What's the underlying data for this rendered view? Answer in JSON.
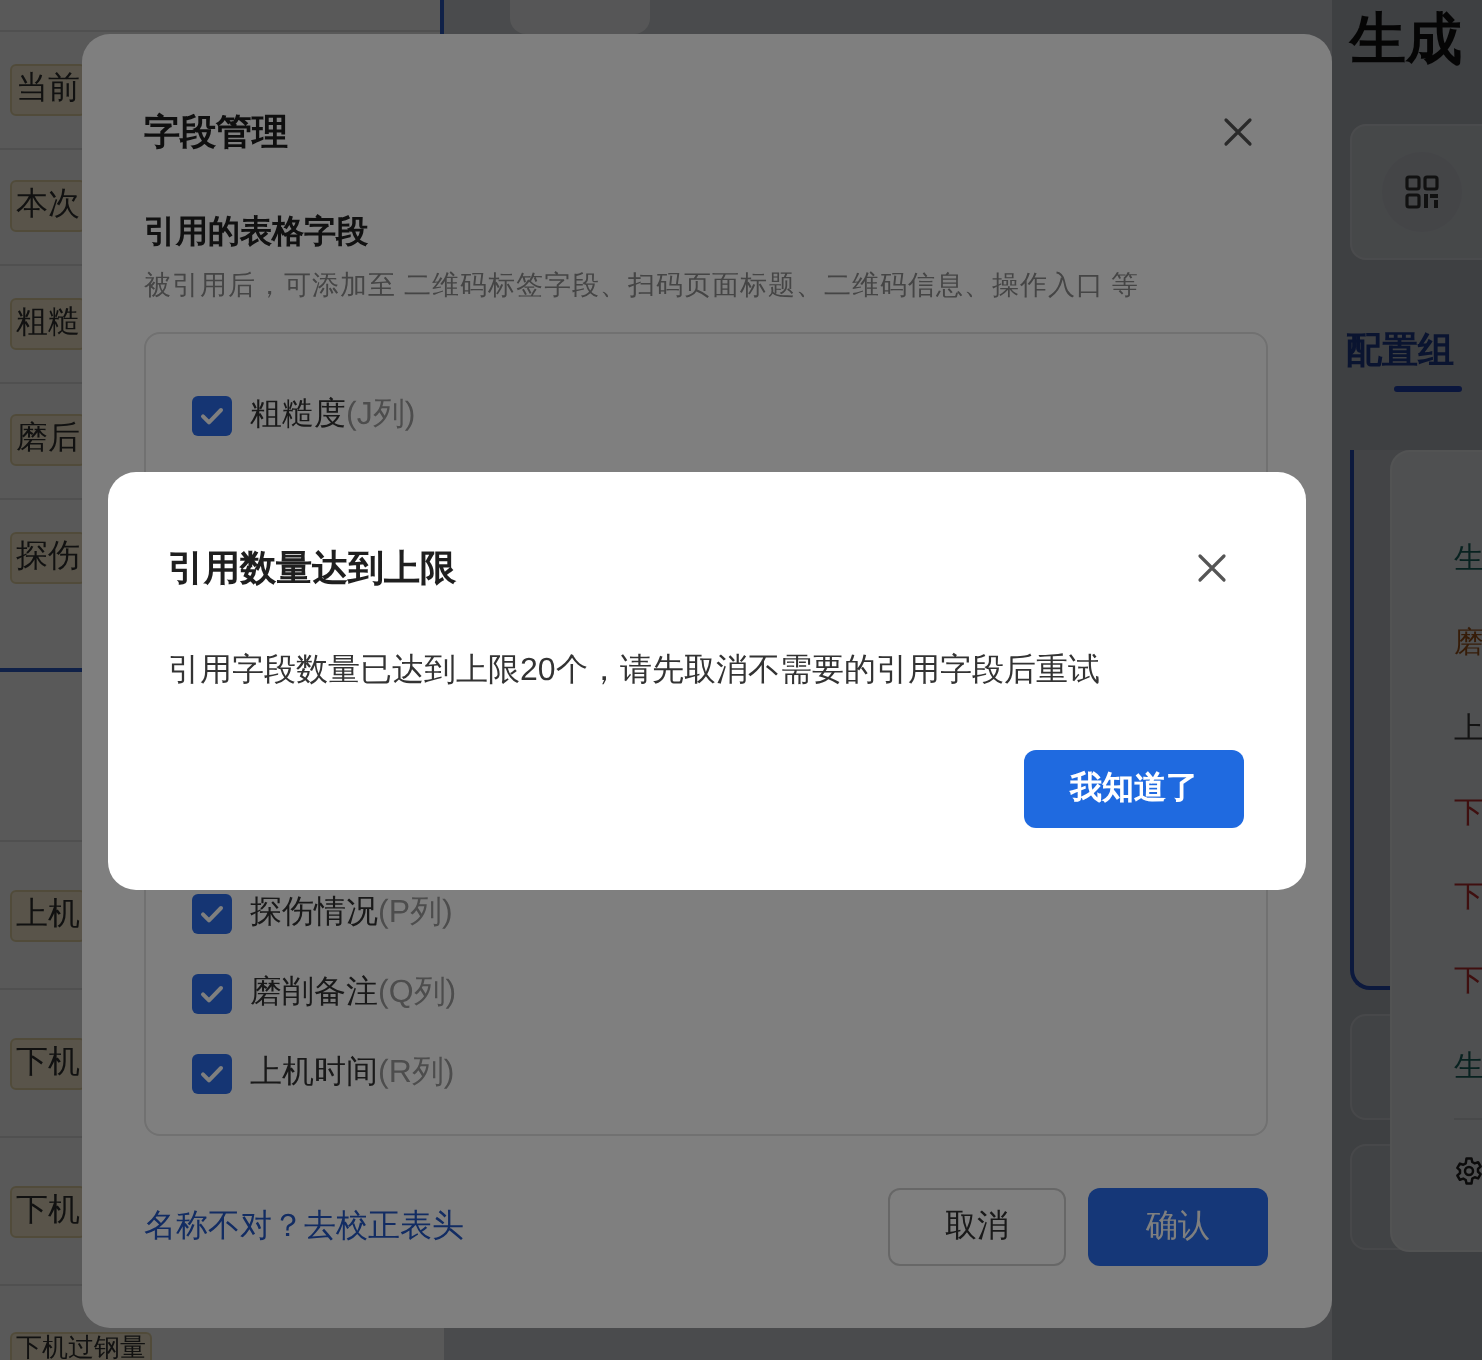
{
  "background": {
    "sidebar": {
      "group_tags": [
        "当前",
        "本次",
        "粗糙",
        "磨后",
        "探伤"
      ],
      "row_tags": [
        "上机",
        "下机",
        "下机",
        "下机过钢量"
      ]
    },
    "title": "生成",
    "tabs": [
      {
        "label": "配置组",
        "selected": true
      }
    ],
    "panel_items": [
      {
        "label": "生",
        "color": "#082220"
      },
      {
        "label": "磨",
        "color": "#361c08"
      },
      {
        "label": "上",
        "color": "#141414"
      },
      {
        "label": "下",
        "color": "#3f0f0f"
      },
      {
        "label": "下",
        "color": "#3f0f0f"
      },
      {
        "label": "下",
        "color": "#3f0f0f"
      },
      {
        "label": "生",
        "color": "#082220"
      }
    ]
  },
  "field_dialog": {
    "title": "字段管理",
    "section_title": "引用的表格字段",
    "description": "被引用后，可添加至 二维码标签字段、扫码页面标题、二维码信息、操作入口 等",
    "fields": [
      {
        "name": "粗糙度",
        "column": "(J列)",
        "checked": true
      },
      {
        "name": "探伤情况",
        "column": "(P列)",
        "checked": true
      },
      {
        "name": "磨削备注",
        "column": "(Q列)",
        "checked": true
      },
      {
        "name": "上机时间",
        "column": "(R列)",
        "checked": true
      }
    ],
    "link": "名称不对？去校正表头",
    "buttons": [
      {
        "label": "取消",
        "kind": "secondary"
      },
      {
        "label": "确认",
        "kind": "primary"
      }
    ]
  },
  "alert_dialog": {
    "title": "引用数量达到上限",
    "message": "引用字段数量已达到上限20个，请先取消不需要的引用字段后重试",
    "button": "我知道了"
  }
}
